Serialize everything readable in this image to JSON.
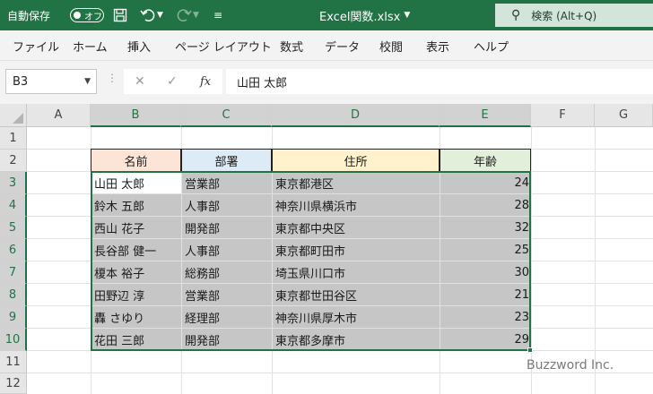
{
  "titlebar": {
    "autosave_label": "自動保存",
    "autosave_state": "オフ",
    "filename": "Excel関数.xlsx",
    "search_placeholder": "検索 (Alt+Q)"
  },
  "ribbon_tabs": [
    "ファイル",
    "ホーム",
    "挿入",
    "ページ レイアウト",
    "数式",
    "データ",
    "校閲",
    "表示",
    "ヘルプ"
  ],
  "formula_bar": {
    "name_box": "B3",
    "fx_label": "fx",
    "content": "山田 太郎"
  },
  "columns": [
    "A",
    "B",
    "C",
    "D",
    "E",
    "F",
    "G"
  ],
  "rows": [
    "1",
    "2",
    "3",
    "4",
    "5",
    "6",
    "7",
    "8",
    "9",
    "10",
    "11",
    "12"
  ],
  "table": {
    "headers": [
      "名前",
      "部署",
      "住所",
      "年齢"
    ],
    "header_colors": [
      "#fce4d6",
      "#ddebf7",
      "#fff2cc",
      "#e2efda"
    ],
    "records": [
      [
        "山田 太郎",
        "営業部",
        "東京都港区",
        "24"
      ],
      [
        "鈴木 五郎",
        "人事部",
        "神奈川県横浜市",
        "28"
      ],
      [
        "西山 花子",
        "開発部",
        "東京都中央区",
        "32"
      ],
      [
        "長谷部 健一",
        "人事部",
        "東京都町田市",
        "25"
      ],
      [
        "榎本 裕子",
        "総務部",
        "埼玉県川口市",
        "30"
      ],
      [
        "田野辺 淳",
        "営業部",
        "東京都世田谷区",
        "21"
      ],
      [
        "轟 さゆり",
        "経理部",
        "神奈川県厚木市",
        "23"
      ],
      [
        "花田 三郎",
        "開発部",
        "東京都多摩市",
        "29"
      ]
    ]
  },
  "colors": {
    "accent": "#217346",
    "selection_fill": "#c6c6c6"
  },
  "watermark": "Buzzword Inc."
}
